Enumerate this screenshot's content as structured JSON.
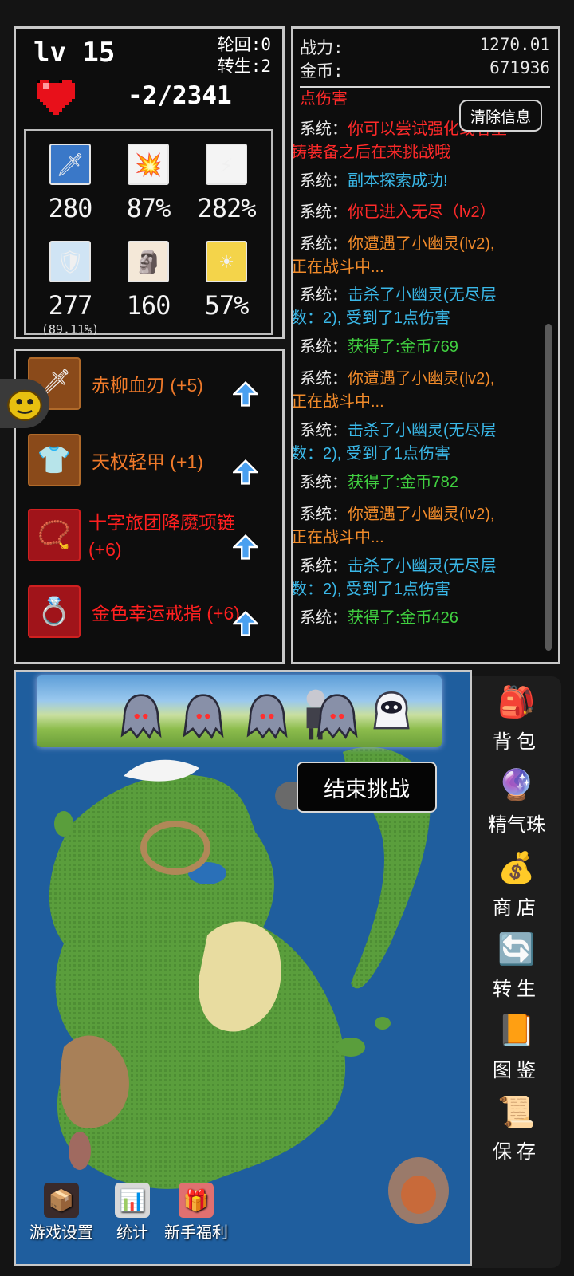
{
  "character": {
    "level": "lv 15",
    "reincarnation": "轮回:0",
    "rebirth": "转生:2",
    "hp": "-2/2341",
    "stats": [
      {
        "icon": "sword-icon",
        "value": "280"
      },
      {
        "icon": "critical-burst-icon",
        "value": "87%"
      },
      {
        "icon": "critical-damage-icon",
        "value": "282%"
      },
      {
        "icon": "shield-icon",
        "value": "277",
        "sub": "(89.11%)"
      },
      {
        "icon": "armor-helmet-icon",
        "value": "160"
      },
      {
        "icon": "luck-coin-icon",
        "value": "57%"
      }
    ]
  },
  "equipment": [
    {
      "icon": "blade-icon",
      "name": "赤柳血刃 (+5)",
      "color": "#f07a2a"
    },
    {
      "icon": "light-armor-icon",
      "name": "天权轻甲 (+1)",
      "color": "#f07a2a"
    },
    {
      "icon": "necklace-icon",
      "name": "十字旅团降魔项链",
      "name2": "(+6)",
      "color": "#ff2020"
    },
    {
      "icon": "gold-ring-icon",
      "name": "金色幸运戒指 (+6)",
      "color": "#ff2020"
    }
  ],
  "header_stats": {
    "power_label": "战力:",
    "power_value": "1270.01",
    "gold_label": "金币:",
    "gold_value": "671936"
  },
  "log": {
    "clear_button": "清除信息",
    "partial_top": "点伤害",
    "entries": [
      {
        "who": "系统：",
        "lines": [
          "你可以尝试强化或者重",
          "铸装备之后在来挑战哦"
        ],
        "color": "#ff2a2a"
      },
      {
        "who": "系统：",
        "lines": [
          "副本探索成功!"
        ],
        "color": "#3ab8e8"
      },
      {
        "who": "系统：",
        "lines": [
          "你已进入无尽（lv2）"
        ],
        "color": "#ff2a2a"
      },
      {
        "who": "系统：",
        "lines": [
          "你遭遇了小幽灵(lv2),",
          "正在战斗中..."
        ],
        "color": "#f08a2a"
      },
      {
        "who": "系统：",
        "lines": [
          "击杀了小幽灵(无尽层",
          "数：2), 受到了1点伤害"
        ],
        "color": "#3ab8e8"
      },
      {
        "who": "系统：",
        "lines": [
          "获得了:金币769"
        ],
        "color": "#40d040"
      },
      {
        "who": "系统：",
        "lines": [
          "你遭遇了小幽灵(lv2),",
          "正在战斗中..."
        ],
        "color": "#f08a2a"
      },
      {
        "who": "系统：",
        "lines": [
          "击杀了小幽灵(无尽层",
          "数：2), 受到了1点伤害"
        ],
        "color": "#3ab8e8"
      },
      {
        "who": "系统：",
        "lines": [
          "获得了:金币782"
        ],
        "color": "#40d040"
      },
      {
        "who": "系统：",
        "lines": [
          "你遭遇了小幽灵(lv2),",
          "正在战斗中..."
        ],
        "color": "#f08a2a"
      },
      {
        "who": "系统：",
        "lines": [
          "击杀了小幽灵(无尽层",
          "数：2), 受到了1点伤害"
        ],
        "color": "#3ab8e8"
      },
      {
        "who": "系统：",
        "lines": [
          "获得了:金币426"
        ],
        "color": "#40d040"
      }
    ]
  },
  "map": {
    "end_challenge": "结束挑战",
    "bottom_buttons": [
      {
        "icon": "settings-chest-icon",
        "label": "游戏设置"
      },
      {
        "icon": "statistics-icon",
        "label": "统计"
      },
      {
        "icon": "newbie-gift-icon",
        "label": "新手福利"
      }
    ]
  },
  "side_menu": [
    {
      "icon": "backpack-icon",
      "label": "背包"
    },
    {
      "icon": "spirit-orb-icon",
      "label": "精气珠"
    },
    {
      "icon": "shop-coins-icon",
      "label": "商店"
    },
    {
      "icon": "rebirth-icon",
      "label": "转生"
    },
    {
      "icon": "codex-book-icon",
      "label": "图鉴"
    },
    {
      "icon": "save-scroll-icon",
      "label": "保存"
    }
  ],
  "colors": {
    "panel_border": "#c8c8c8",
    "ocean": "#1e5c9c",
    "land": "#5a9e3c",
    "sand": "#e8dca0"
  }
}
